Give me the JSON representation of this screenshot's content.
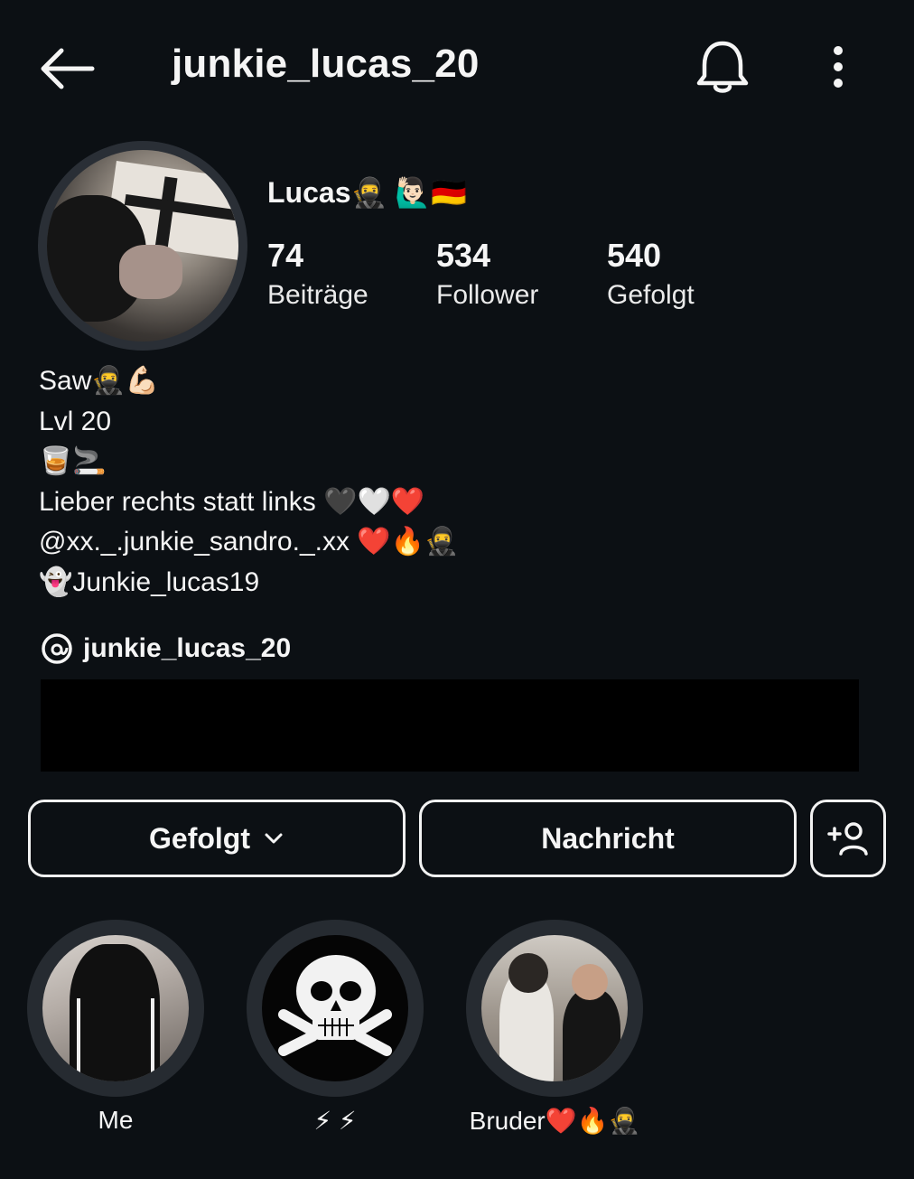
{
  "header": {
    "username": "junkie_lucas_20"
  },
  "profile": {
    "display_name": "Lucas🥷 🙋🏻‍♂️🇩🇪",
    "stats": [
      {
        "value": "74",
        "label": "Beiträge"
      },
      {
        "value": "534",
        "label": "Follower"
      },
      {
        "value": "540",
        "label": "Gefolgt"
      }
    ],
    "bio_lines": [
      "Saw🥷💪🏻",
      "Lvl 20",
      "🥃🚬",
      "Lieber rechts statt links 🖤🤍❤️",
      "@xx._.junkie_sandro._.xx ❤️🔥🥷",
      "👻Junkie_lucas19"
    ],
    "threads_handle": "junkie_lucas_20"
  },
  "actions": {
    "follow_label": "Gefolgt",
    "message_label": "Nachricht"
  },
  "highlights": [
    {
      "name": "Me"
    },
    {
      "name": "⚡ ⚡"
    },
    {
      "name": "Bruder❤️🔥🥷"
    }
  ],
  "icons": {
    "back": "back-arrow-icon",
    "notifications": "bell-icon",
    "more": "more-vertical-icon",
    "threads": "threads-icon",
    "dropdown": "chevron-down-icon",
    "add_user": "add-user-icon"
  },
  "colors": {
    "background": "#0c1014",
    "text": "#f5f5f5",
    "button_border": "#f2f2f2"
  }
}
